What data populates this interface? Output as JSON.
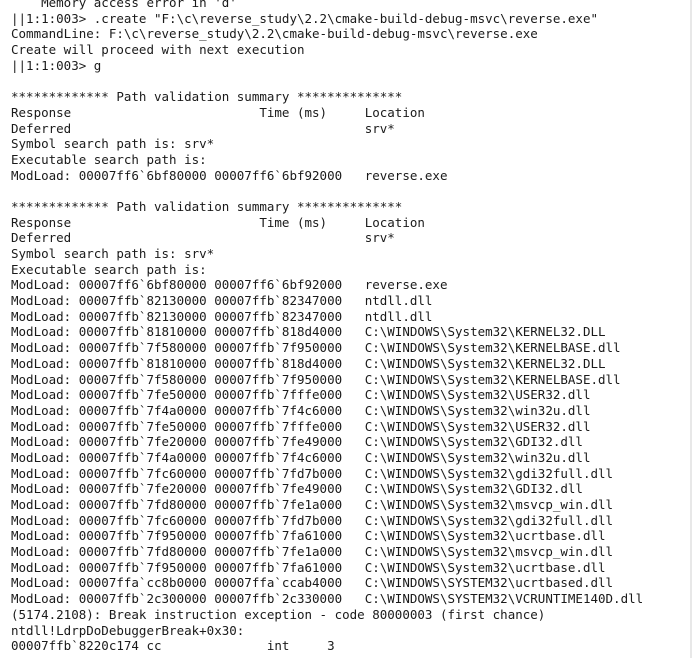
{
  "console": {
    "lines": [
      "    Memory access error in 'd'",
      "||1:1:003> .create \"F:\\c\\reverse_study\\2.2\\cmake-build-debug-msvc\\reverse.exe\"",
      "CommandLine: F:\\c\\reverse_study\\2.2\\cmake-build-debug-msvc\\reverse.exe",
      "Create will proceed with next execution",
      "||1:1:003> g",
      "",
      "************* Path validation summary **************",
      "Response                         Time (ms)     Location",
      "Deferred                                       srv*",
      "Symbol search path is: srv*",
      "Executable search path is:",
      "ModLoad: 00007ff6`6bf80000 00007ff6`6bf92000   reverse.exe",
      "",
      "************* Path validation summary **************",
      "Response                         Time (ms)     Location",
      "Deferred                                       srv*",
      "Symbol search path is: srv*",
      "Executable search path is:",
      "ModLoad: 00007ff6`6bf80000 00007ff6`6bf92000   reverse.exe",
      "ModLoad: 00007ffb`82130000 00007ffb`82347000   ntdll.dll",
      "ModLoad: 00007ffb`82130000 00007ffb`82347000   ntdll.dll",
      "ModLoad: 00007ffb`81810000 00007ffb`818d4000   C:\\WINDOWS\\System32\\KERNEL32.DLL",
      "ModLoad: 00007ffb`7f580000 00007ffb`7f950000   C:\\WINDOWS\\System32\\KERNELBASE.dll",
      "ModLoad: 00007ffb`81810000 00007ffb`818d4000   C:\\WINDOWS\\System32\\KERNEL32.DLL",
      "ModLoad: 00007ffb`7f580000 00007ffb`7f950000   C:\\WINDOWS\\System32\\KERNELBASE.dll",
      "ModLoad: 00007ffb`7fe50000 00007ffb`7fffe000   C:\\WINDOWS\\System32\\USER32.dll",
      "ModLoad: 00007ffb`7f4a0000 00007ffb`7f4c6000   C:\\WINDOWS\\System32\\win32u.dll",
      "ModLoad: 00007ffb`7fe50000 00007ffb`7fffe000   C:\\WINDOWS\\System32\\USER32.dll",
      "ModLoad: 00007ffb`7fe20000 00007ffb`7fe49000   C:\\WINDOWS\\System32\\GDI32.dll",
      "ModLoad: 00007ffb`7f4a0000 00007ffb`7f4c6000   C:\\WINDOWS\\System32\\win32u.dll",
      "ModLoad: 00007ffb`7fc60000 00007ffb`7fd7b000   C:\\WINDOWS\\System32\\gdi32full.dll",
      "ModLoad: 00007ffb`7fe20000 00007ffb`7fe49000   C:\\WINDOWS\\System32\\GDI32.dll",
      "ModLoad: 00007ffb`7fd80000 00007ffb`7fe1a000   C:\\WINDOWS\\System32\\msvcp_win.dll",
      "ModLoad: 00007ffb`7fc60000 00007ffb`7fd7b000   C:\\WINDOWS\\System32\\gdi32full.dll",
      "ModLoad: 00007ffb`7f950000 00007ffb`7fa61000   C:\\WINDOWS\\System32\\ucrtbase.dll",
      "ModLoad: 00007ffb`7fd80000 00007ffb`7fe1a000   C:\\WINDOWS\\System32\\msvcp_win.dll",
      "ModLoad: 00007ffb`7f950000 00007ffb`7fa61000   C:\\WINDOWS\\System32\\ucrtbase.dll",
      "ModLoad: 00007ffa`cc8b0000 00007ffa`ccab4000   C:\\WINDOWS\\SYSTEM32\\ucrtbased.dll",
      "ModLoad: 00007ffb`2c300000 00007ffb`2c330000   C:\\WINDOWS\\SYSTEM32\\VCRUNTIME140D.dll",
      "(5174.2108): Break instruction exception - code 80000003 (first chance)",
      "ntdll!LdrpDoDebuggerBreak+0x30:",
      "00007ffb`8220c174 cc              int     3"
    ]
  }
}
